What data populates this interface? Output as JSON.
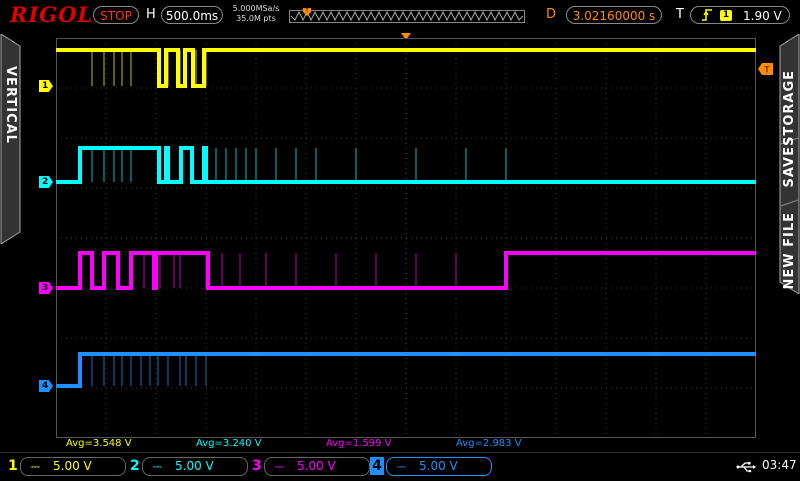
{
  "brand": "RIGOL",
  "run_state": "STOP",
  "horizontal": {
    "label": "H",
    "timebase": "500.0ms",
    "sample_rate": "5.000MSa/s",
    "memory_depth": "35.0M pts"
  },
  "delay": {
    "label": "D",
    "value": "3.02160000 s"
  },
  "trigger": {
    "label": "T",
    "source": "1",
    "level": "1.90 V",
    "edge_icon": "rising-edge-icon"
  },
  "menus": {
    "left": "VERTICAL",
    "storage": "STORAGE",
    "save": "SAVE",
    "new_file": "NEW FILE"
  },
  "markers": {
    "trigger_level": "T",
    "trigger_pos": "T"
  },
  "channels": [
    {
      "id": "1",
      "color": "#ffff00",
      "scale": "5.00 V",
      "avg": "Avg=3.548 V",
      "coupling": "DC"
    },
    {
      "id": "2",
      "color": "#00ffff",
      "scale": "5.00 V",
      "avg": "Avg=3.240 V",
      "coupling": "DC"
    },
    {
      "id": "3",
      "color": "#ff00ff",
      "scale": "5.00 V",
      "avg": "Avg=1.599 V",
      "coupling": "DC"
    },
    {
      "id": "4",
      "color": "#1e90ff",
      "scale": "5.00 V",
      "avg": "Avg=2.983 V",
      "coupling": "DC"
    }
  ],
  "status": {
    "time": "03:47",
    "usb_icon": "usb-icon"
  }
}
